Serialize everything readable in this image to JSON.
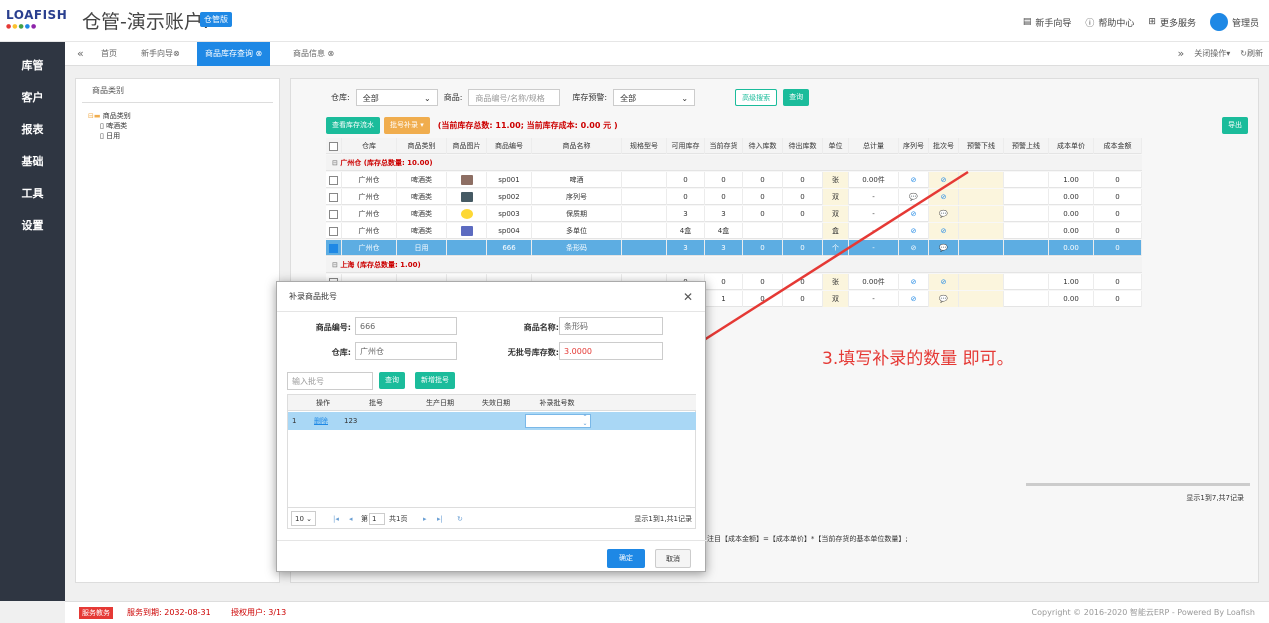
{
  "header": {
    "logo": "LOAFISH",
    "title": "仓管-演示账户.",
    "badge": "仓管版",
    "nav": [
      {
        "icon": "guide-icon",
        "label": "新手向导"
      },
      {
        "icon": "help-icon",
        "label": "帮助中心"
      },
      {
        "icon": "grid-icon",
        "label": "更多服务"
      },
      {
        "icon": "user-icon",
        "label": "管理员"
      }
    ]
  },
  "sidebar": {
    "items": [
      "库管",
      "客户",
      "报表",
      "基础",
      "工具",
      "设置"
    ]
  },
  "tabs": {
    "items": [
      {
        "label": "首页",
        "active": false
      },
      {
        "label": "新手向导⊗",
        "active": false
      },
      {
        "label": "商品库存查询 ⊗",
        "active": true
      },
      {
        "label": "商品信息 ⊗",
        "active": false
      }
    ],
    "close_ops": "关闭操作▾",
    "refresh": "刷新"
  },
  "category": {
    "header": "商品类别",
    "tree": [
      "商品类别",
      "啤酒类",
      "日用"
    ]
  },
  "filter": {
    "warehouse_label": "仓库:",
    "warehouse_value": "全部",
    "product_label": "商品:",
    "product_placeholder": "商品编号/名称/规格",
    "warn_label": "库存预警:",
    "warn_value": "全部",
    "advanced": "高级搜索",
    "query": "查询"
  },
  "toolbar": {
    "flow_btn": "查看库存流水",
    "batch_btn": "批号补录",
    "summary": "(当前库存总数: 11.00; 当前库存成本: 0.00 元 )",
    "export": "导出"
  },
  "grid": {
    "columns": [
      "仓库",
      "商品类别",
      "商品图片",
      "商品编号",
      "商品名称",
      "规格型号",
      "可用库存",
      "当前存货",
      "待入库数",
      "待出库数",
      "单位",
      "总计量",
      "序列号",
      "批次号",
      "预警下线",
      "预警上线",
      "成本单价",
      "成本金额"
    ],
    "groups": [
      {
        "title": "广州仓 (库存总数量: 10.00)",
        "rows": [
          {
            "wh": "广州仓",
            "cat": "啤酒类",
            "code": "sp001",
            "name": "啤酒",
            "avail": "0",
            "cur": "0",
            "in": "0",
            "out": "0",
            "unit": "张",
            "total": "0.00件",
            "serial": "⊘",
            "batch": "⊘",
            "price": "1.00",
            "amt": "0",
            "selected": false
          },
          {
            "wh": "广州仓",
            "cat": "啤酒类",
            "code": "sp002",
            "name": "序列号",
            "avail": "0",
            "cur": "0",
            "in": "0",
            "out": "0",
            "unit": "双",
            "total": "-",
            "serial": "💬",
            "batch": "⊘",
            "price": "0.00",
            "amt": "0",
            "selected": false
          },
          {
            "wh": "广州仓",
            "cat": "啤酒类",
            "code": "sp003",
            "name": "保质期",
            "avail": "3",
            "cur": "3",
            "in": "0",
            "out": "0",
            "unit": "双",
            "total": "-",
            "serial": "⊘",
            "batch": "💬",
            "price": "0.00",
            "amt": "0",
            "selected": false
          },
          {
            "wh": "广州仓",
            "cat": "啤酒类",
            "code": "sp004",
            "name": "多单位",
            "avail": "4盒",
            "cur": "4盒",
            "in": "",
            "out": "",
            "unit": "盒",
            "total": "-",
            "serial": "⊘",
            "batch": "⊘",
            "price": "0.00",
            "amt": "0",
            "selected": false
          },
          {
            "wh": "广州仓",
            "cat": "日用",
            "code": "666",
            "name": "条形码",
            "avail": "3",
            "cur": "3",
            "in": "0",
            "out": "0",
            "unit": "个",
            "total": "-",
            "serial": "⊘",
            "batch": "💬",
            "price": "0.00",
            "amt": "0",
            "selected": true
          }
        ]
      },
      {
        "title": "上海 (库存总数量: 1.00)",
        "rows": [
          {
            "wh": "",
            "cat": "",
            "code": "",
            "name": "",
            "avail": "0",
            "cur": "0",
            "in": "0",
            "out": "0",
            "unit": "张",
            "total": "0.00件",
            "serial": "⊘",
            "batch": "⊘",
            "price": "1.00",
            "amt": "0",
            "selected": false
          },
          {
            "wh": "",
            "cat": "",
            "code": "",
            "name": "",
            "avail": "1",
            "cur": "1",
            "in": "0",
            "out": "0",
            "unit": "双",
            "total": "-",
            "serial": "⊘",
            "batch": "💬",
            "price": "0.00",
            "amt": "0",
            "selected": false
          }
        ]
      }
    ],
    "record_info": "显示1到7,共7记录",
    "footnote": "注目【成本金额】=【成本单价】*【当前存货的基本单位数量】;"
  },
  "modal": {
    "title": "补录商品批号",
    "code_label": "商品编号:",
    "code_value": "666",
    "name_label": "商品名称:",
    "name_value": "条形码",
    "wh_label": "仓库:",
    "wh_value": "广州仓",
    "nobatch_label": "无批号库存数:",
    "nobatch_value": "3.0000",
    "batch_placeholder": "输入批号",
    "query": "查询",
    "add_batch": "新增批号",
    "columns": [
      "操作",
      "批号",
      "生产日期",
      "失效日期",
      "补录批号数"
    ],
    "rows": [
      {
        "idx": "1",
        "op": "删除",
        "batch": "123",
        "prod": "",
        "exp": "",
        "qty": ""
      }
    ],
    "pager": {
      "size": "10",
      "page_label": "第",
      "page": "1",
      "total_pages": "共1页",
      "info": "显示1到1,共1记录"
    },
    "confirm": "确定",
    "cancel": "取消"
  },
  "annotation": "3.填写补录的数量 即可。",
  "status": {
    "badge": "服务教务",
    "expire": "服务到期: 2032-08-31",
    "users": "授权用户: 3/13",
    "copyright": "Copyright © 2016-2020 智能云ERP - Powered By Loafish"
  },
  "colors": {
    "primary": "#1e88e5",
    "teal": "#1bbc9b",
    "orange": "#f0ad4e",
    "sidebar": "#2f3642",
    "warn": "#e53935"
  }
}
